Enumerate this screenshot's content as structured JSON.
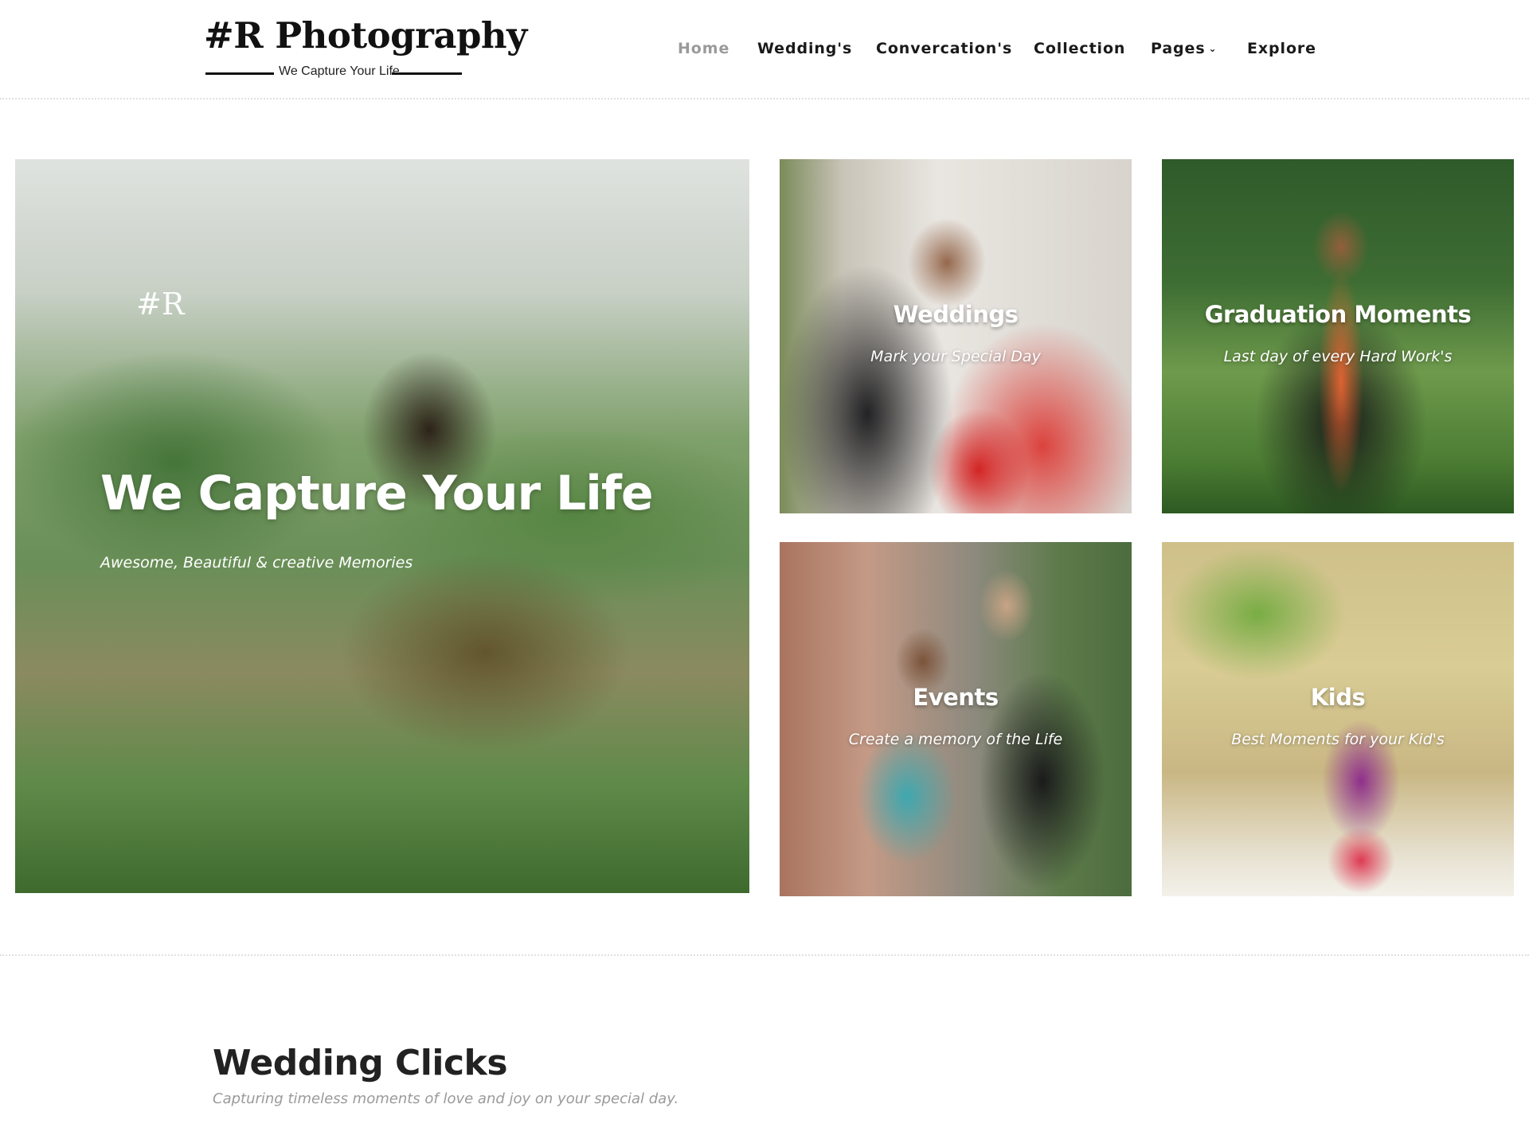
{
  "logo": {
    "title": "#R Photography",
    "tagline": "We Capture Your Life"
  },
  "nav": {
    "items": [
      {
        "label": "Home",
        "active": true
      },
      {
        "label": "Wedding's"
      },
      {
        "label": "Convercation's"
      },
      {
        "label": "Collection"
      },
      {
        "label": "Pages"
      },
      {
        "label": "Explore"
      }
    ],
    "pages_dropdown_icon": "chevron-down-icon"
  },
  "hero": {
    "badge": "#R",
    "title": "We Capture Your Life",
    "subtitle": "Awesome, Beautiful & creative Memories"
  },
  "categories": [
    {
      "title": "Weddings",
      "subtitle": "Mark your Special Day"
    },
    {
      "title": "Graduation Moments",
      "subtitle": "Last day of every Hard Work's"
    },
    {
      "title": "Events",
      "subtitle": "Create a memory of the Life"
    },
    {
      "title": "Kids",
      "subtitle": "Best Moments for your Kid's"
    }
  ],
  "section": {
    "title": "Wedding Clicks",
    "subtitle": "Capturing timeless moments of love and joy on your special day."
  },
  "colors": {
    "nav_text": "#1a1a1a",
    "nav_active": "#9a9a9a",
    "divider": "#e0e0e0"
  }
}
